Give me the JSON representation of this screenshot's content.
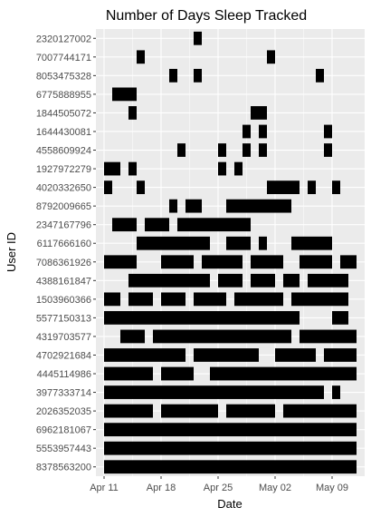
{
  "chart_data": {
    "type": "timeline",
    "title": "Number of Days Sleep Tracked",
    "xlabel": "Date",
    "ylabel": "User ID",
    "x_ticks": [
      "Apr 11",
      "Apr 18",
      "Apr 25",
      "May 02",
      "May 09"
    ],
    "x_tick_dates": [
      "2016-04-11",
      "2016-04-18",
      "2016-04-25",
      "2016-05-02",
      "2016-05-09"
    ],
    "x_range": [
      "2016-04-10",
      "2016-05-13"
    ],
    "grid": true,
    "panel_color": "#ebebeb",
    "bar_color": "#000000",
    "users": [
      {
        "id": "2320127002",
        "days": [
          [
            "2016-04-22",
            "2016-04-23"
          ]
        ]
      },
      {
        "id": "7007744171",
        "days": [
          [
            "2016-04-15",
            "2016-04-16"
          ],
          [
            "2016-05-01",
            "2016-05-02"
          ]
        ]
      },
      {
        "id": "8053475328",
        "days": [
          [
            "2016-04-19",
            "2016-04-20"
          ],
          [
            "2016-04-22",
            "2016-04-23"
          ],
          [
            "2016-05-07",
            "2016-05-08"
          ]
        ]
      },
      {
        "id": "6775888955",
        "days": [
          [
            "2016-04-12",
            "2016-04-15"
          ]
        ]
      },
      {
        "id": "1844505072",
        "days": [
          [
            "2016-04-14",
            "2016-04-15"
          ],
          [
            "2016-04-29",
            "2016-05-01"
          ]
        ]
      },
      {
        "id": "1644430081",
        "days": [
          [
            "2016-04-28",
            "2016-04-29"
          ],
          [
            "2016-04-30",
            "2016-05-01"
          ],
          [
            "2016-05-08",
            "2016-05-09"
          ]
        ]
      },
      {
        "id": "4558609924",
        "days": [
          [
            "2016-04-20",
            "2016-04-21"
          ],
          [
            "2016-04-25",
            "2016-04-26"
          ],
          [
            "2016-04-28",
            "2016-04-29"
          ],
          [
            "2016-04-30",
            "2016-05-01"
          ],
          [
            "2016-05-08",
            "2016-05-09"
          ]
        ]
      },
      {
        "id": "1927972279",
        "days": [
          [
            "2016-04-11",
            "2016-04-13"
          ],
          [
            "2016-04-14",
            "2016-04-15"
          ],
          [
            "2016-04-25",
            "2016-04-26"
          ],
          [
            "2016-04-27",
            "2016-04-28"
          ]
        ]
      },
      {
        "id": "4020332650",
        "days": [
          [
            "2016-04-11",
            "2016-04-12"
          ],
          [
            "2016-04-15",
            "2016-04-16"
          ],
          [
            "2016-05-01",
            "2016-05-05"
          ],
          [
            "2016-05-06",
            "2016-05-07"
          ],
          [
            "2016-05-09",
            "2016-05-10"
          ]
        ]
      },
      {
        "id": "8792009665",
        "days": [
          [
            "2016-04-19",
            "2016-04-20"
          ],
          [
            "2016-04-21",
            "2016-04-23"
          ],
          [
            "2016-04-26",
            "2016-05-04"
          ]
        ]
      },
      {
        "id": "2347167796",
        "days": [
          [
            "2016-04-12",
            "2016-04-15"
          ],
          [
            "2016-04-16",
            "2016-04-19"
          ],
          [
            "2016-04-20",
            "2016-04-29"
          ]
        ]
      },
      {
        "id": "6117666160",
        "days": [
          [
            "2016-04-15",
            "2016-04-24"
          ],
          [
            "2016-04-26",
            "2016-04-29"
          ],
          [
            "2016-04-30",
            "2016-05-01"
          ],
          [
            "2016-05-04",
            "2016-05-09"
          ]
        ]
      },
      {
        "id": "7086361926",
        "days": [
          [
            "2016-04-11",
            "2016-04-15"
          ],
          [
            "2016-04-18",
            "2016-04-22"
          ],
          [
            "2016-04-23",
            "2016-04-28"
          ],
          [
            "2016-04-29",
            "2016-05-03"
          ],
          [
            "2016-05-05",
            "2016-05-09"
          ],
          [
            "2016-05-10",
            "2016-05-12"
          ]
        ]
      },
      {
        "id": "4388161847",
        "days": [
          [
            "2016-04-14",
            "2016-04-24"
          ],
          [
            "2016-04-25",
            "2016-04-28"
          ],
          [
            "2016-04-29",
            "2016-05-02"
          ],
          [
            "2016-05-03",
            "2016-05-05"
          ],
          [
            "2016-05-06",
            "2016-05-11"
          ]
        ]
      },
      {
        "id": "1503960366",
        "days": [
          [
            "2016-04-11",
            "2016-04-13"
          ],
          [
            "2016-04-14",
            "2016-04-17"
          ],
          [
            "2016-04-18",
            "2016-04-21"
          ],
          [
            "2016-04-22",
            "2016-04-26"
          ],
          [
            "2016-04-27",
            "2016-05-03"
          ],
          [
            "2016-05-04",
            "2016-05-11"
          ]
        ]
      },
      {
        "id": "5577150313",
        "days": [
          [
            "2016-04-11",
            "2016-05-05"
          ],
          [
            "2016-05-09",
            "2016-05-11"
          ]
        ]
      },
      {
        "id": "4319703577",
        "days": [
          [
            "2016-04-13",
            "2016-04-16"
          ],
          [
            "2016-04-17",
            "2016-05-04"
          ],
          [
            "2016-05-05",
            "2016-05-12"
          ]
        ]
      },
      {
        "id": "4702921684",
        "days": [
          [
            "2016-04-11",
            "2016-04-21"
          ],
          [
            "2016-04-22",
            "2016-04-30"
          ],
          [
            "2016-05-02",
            "2016-05-07"
          ],
          [
            "2016-05-08",
            "2016-05-12"
          ]
        ]
      },
      {
        "id": "4445114986",
        "days": [
          [
            "2016-04-11",
            "2016-04-17"
          ],
          [
            "2016-04-18",
            "2016-04-22"
          ],
          [
            "2016-04-24",
            "2016-05-12"
          ]
        ]
      },
      {
        "id": "3977333714",
        "days": [
          [
            "2016-04-11",
            "2016-05-08"
          ],
          [
            "2016-05-09",
            "2016-05-10"
          ]
        ]
      },
      {
        "id": "2026352035",
        "days": [
          [
            "2016-04-11",
            "2016-04-17"
          ],
          [
            "2016-04-18",
            "2016-04-25"
          ],
          [
            "2016-04-26",
            "2016-05-02"
          ],
          [
            "2016-05-03",
            "2016-05-12"
          ]
        ]
      },
      {
        "id": "6962181067",
        "days": [
          [
            "2016-04-11",
            "2016-05-12"
          ]
        ]
      },
      {
        "id": "5553957443",
        "days": [
          [
            "2016-04-11",
            "2016-05-12"
          ]
        ]
      },
      {
        "id": "8378563200",
        "days": [
          [
            "2016-04-11",
            "2016-05-12"
          ]
        ]
      }
    ]
  }
}
